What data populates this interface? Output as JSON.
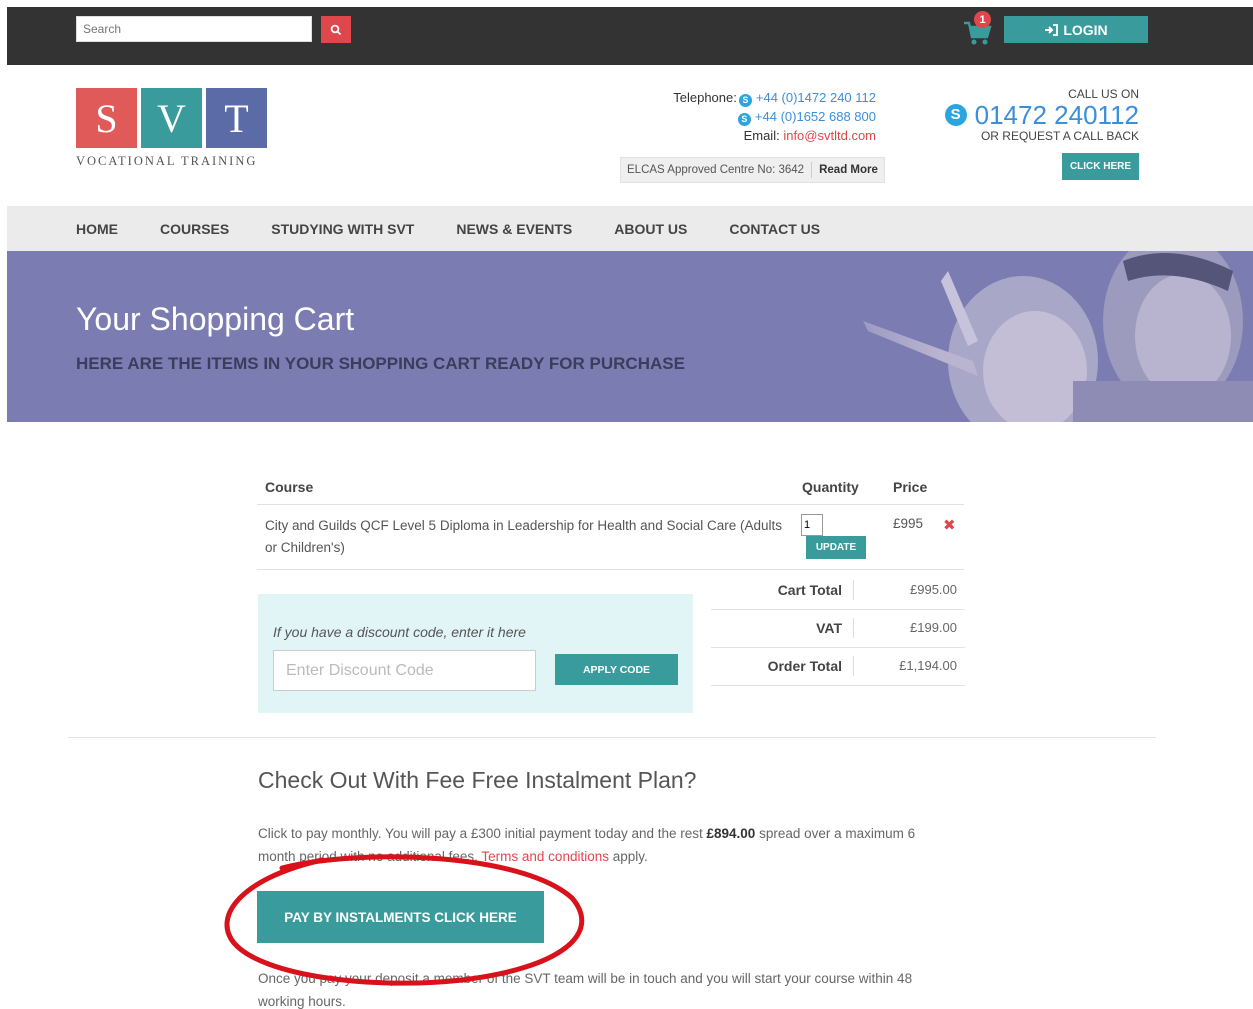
{
  "topbar": {
    "search_placeholder": "Search",
    "cart_count": "1",
    "login_label": "LOGIN"
  },
  "logo": {
    "letters": [
      "S",
      "V",
      "T"
    ],
    "subtitle": "VOCATIONAL TRAINING"
  },
  "contact": {
    "telephone_label": "Telephone:",
    "phone1": "+44 (0)1472 240 112",
    "phone2": "+44 (0)1652 688 800",
    "email_label": "Email:",
    "email": "info@svtltd.com",
    "elcas_text": "ELCAS Approved Centre No: 3642",
    "read_more": "Read More"
  },
  "callus": {
    "label": "CALL US ON",
    "number": "01472 240112",
    "request": "OR REQUEST A CALL BACK",
    "button": "CLICK HERE"
  },
  "nav": [
    "HOME",
    "COURSES",
    "STUDYING WITH SVT",
    "NEWS & EVENTS",
    "ABOUT US",
    "CONTACT US"
  ],
  "hero": {
    "title": "Your Shopping Cart",
    "subtitle": "HERE ARE THE ITEMS IN YOUR SHOPPING CART READY FOR PURCHASE"
  },
  "cart": {
    "headers": {
      "course": "Course",
      "quantity": "Quantity",
      "price": "Price"
    },
    "item": {
      "name": "City and Guilds QCF Level 5 Diploma in Leadership for Health and Social Care (Adults or Children's)",
      "quantity": "1",
      "price": "£995",
      "update_label": "UPDATE"
    },
    "discount": {
      "label": "If you have a discount code, enter it here",
      "placeholder": "Enter Discount Code",
      "button": "APPLY CODE"
    },
    "totals": [
      {
        "label": "Cart Total",
        "value": "£995.00"
      },
      {
        "label": "VAT",
        "value": "£199.00"
      },
      {
        "label": "Order Total",
        "value": "£1,194.00"
      }
    ]
  },
  "instalment": {
    "title": "Check Out With Fee Free Instalment Plan?",
    "text_before": "Click to pay monthly. You will pay a £300 initial payment today and the rest ",
    "amount": "£894.00",
    "text_middle": " spread over a maximum 6 month period with no additional fees. ",
    "terms_link": "Terms and conditions",
    "text_after": " apply.",
    "button": "PAY BY INSTALMENTS CLICK HERE",
    "after_text": "Once you pay your deposit a member of the SVT team will be in touch and you will start your course within 48 working hours."
  },
  "colors": {
    "teal": "#3a9b9d",
    "red": "#e0474c",
    "hero_purple": "#7b7db2",
    "annotation_red": "#d8111b"
  }
}
